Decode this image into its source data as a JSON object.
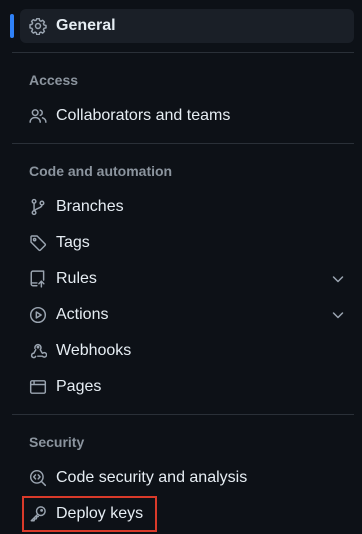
{
  "nav": {
    "general": {
      "label": "General",
      "icon": "gear-icon",
      "active": true
    },
    "sections": {
      "access": {
        "heading": "Access",
        "items": [
          {
            "label": "Collaborators and teams",
            "icon": "people-icon"
          }
        ]
      },
      "code_automation": {
        "heading": "Code and automation",
        "items": [
          {
            "label": "Branches",
            "icon": "git-branch-icon"
          },
          {
            "label": "Tags",
            "icon": "tag-icon"
          },
          {
            "label": "Rules",
            "icon": "repo-push-icon",
            "expandable": true
          },
          {
            "label": "Actions",
            "icon": "play-icon",
            "expandable": true
          },
          {
            "label": "Webhooks",
            "icon": "webhook-icon"
          },
          {
            "label": "Pages",
            "icon": "browser-icon"
          }
        ]
      },
      "security": {
        "heading": "Security",
        "items": [
          {
            "label": "Code security and analysis",
            "icon": "codescan-icon"
          },
          {
            "label": "Deploy keys",
            "icon": "key-icon",
            "highlighted": true
          }
        ]
      }
    }
  },
  "colors": {
    "background": "#0d1117",
    "active_item_bg": "#1a1f27",
    "active_indicator": "#2f81f7",
    "highlight_border": "#d93a2a",
    "text": "#e6edf3",
    "muted": "#8b949e"
  }
}
